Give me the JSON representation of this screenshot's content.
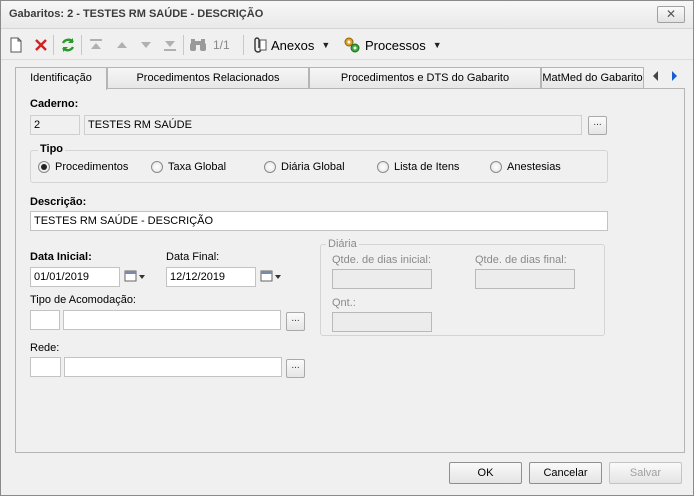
{
  "window": {
    "title": "Gabaritos: 2 - TESTES RM SAÚDE - DESCRIÇÃO",
    "close_glyph": "✕"
  },
  "toolbar": {
    "pager": "1/1",
    "anexos_label": "Anexos",
    "processos_label": "Processos",
    "caret": "▼"
  },
  "tabs": [
    {
      "label": "Identificação",
      "active": true
    },
    {
      "label": "Procedimentos Relacionados"
    },
    {
      "label": "Procedimentos e DTS do Gabarito"
    },
    {
      "label": "MatMed do Gabarito"
    }
  ],
  "form": {
    "caderno": {
      "label": "Caderno:",
      "code": "2",
      "name": "TESTES RM SAÚDE"
    },
    "tipo": {
      "label": "Tipo",
      "options": [
        "Procedimentos",
        "Taxa Global",
        "Diária Global",
        "Lista de Itens",
        "Anestesias"
      ],
      "selected": "Procedimentos"
    },
    "descricao": {
      "label": "Descrição:",
      "value": "TESTES RM SAÚDE - DESCRIÇÃO"
    },
    "data_inicial": {
      "label": "Data Inicial:",
      "value": "01/01/2019"
    },
    "data_final": {
      "label": "Data Final:",
      "value": "12/12/2019"
    },
    "tipo_acomodacao": {
      "label": "Tipo de Acomodação:",
      "code": "",
      "name": ""
    },
    "rede": {
      "label": "Rede:",
      "code": "",
      "name": ""
    },
    "diaria": {
      "label": "Diária",
      "qtde_inicial_label": "Qtde. de dias inicial:",
      "qtde_final_label": "Qtde. de dias final:",
      "qnt_label": "Qnt.:",
      "qtde_inicial": "",
      "qtde_final": "",
      "qnt": ""
    },
    "ellipsis": "..."
  },
  "buttons": {
    "ok": "OK",
    "cancelar": "Cancelar",
    "salvar": "Salvar"
  }
}
